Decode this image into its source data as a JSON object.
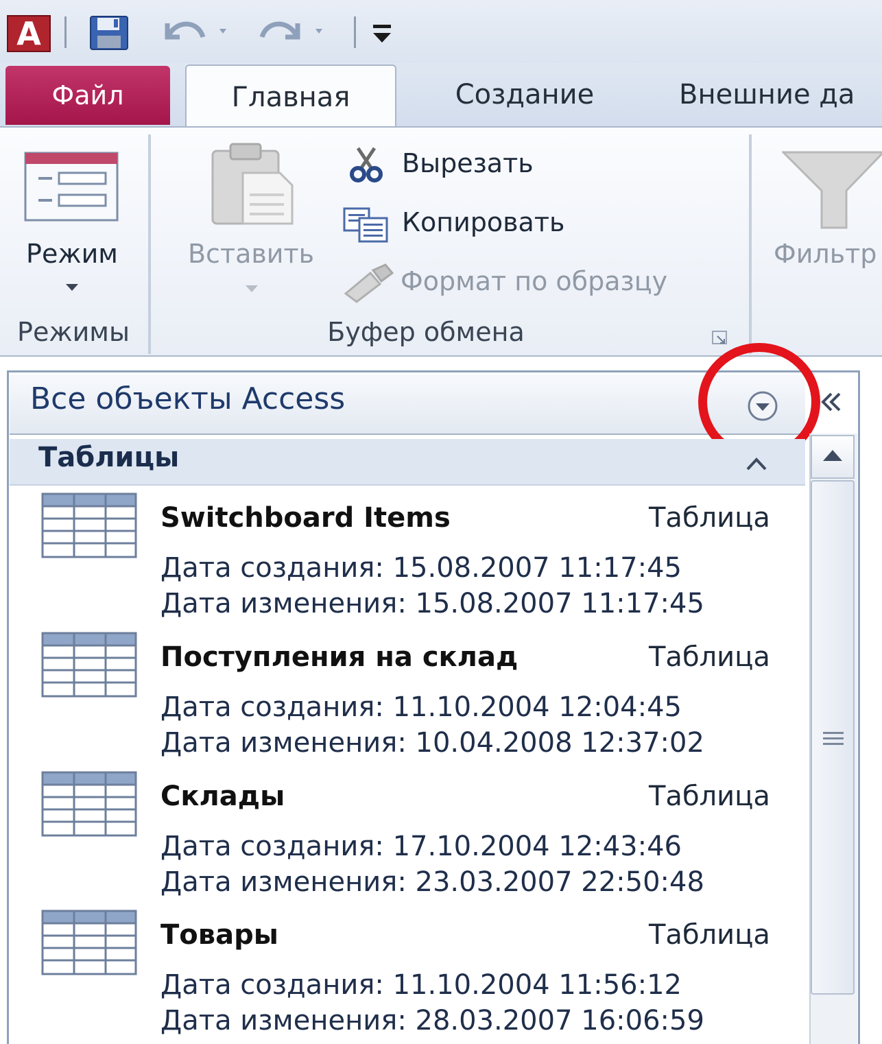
{
  "quick_access": {
    "logo_letter": "A"
  },
  "tabs": {
    "file": "Файл",
    "home": "Главная",
    "create": "Создание",
    "external": "Внешние да"
  },
  "ribbon": {
    "views": {
      "button_label": "Режим",
      "group_label": "Режимы"
    },
    "clipboard": {
      "paste_label": "Вставить",
      "cut_label": "Вырезать",
      "copy_label": "Копировать",
      "format_painter_label": "Формат по образцу",
      "group_label": "Буфер обмена"
    },
    "filter": {
      "button_label": "Фильтр"
    }
  },
  "nav_pane": {
    "title": "Все объекты Access",
    "group": {
      "title": "Таблицы"
    },
    "items": [
      {
        "name": "Switchboard Items",
        "type": "Таблица",
        "created": "Дата создания: 15.08.2007 11:17:45",
        "modified": "Дата изменения: 15.08.2007 11:17:45"
      },
      {
        "name": "Поступления на склад",
        "type": "Таблица",
        "created": "Дата создания: 11.10.2004 12:04:45",
        "modified": "Дата изменения: 10.04.2008 12:37:02"
      },
      {
        "name": "Склады",
        "type": "Таблица",
        "created": "Дата создания: 17.10.2004 12:43:46",
        "modified": "Дата изменения: 23.03.2007 22:50:48"
      },
      {
        "name": "Товары",
        "type": "Таблица",
        "created": "Дата создания: 11.10.2004 11:56:12",
        "modified": "Дата изменения: 28.03.2007 16:06:59"
      }
    ]
  },
  "colors": {
    "file_tab": "#b11f53",
    "highlight_circle": "#e3141b",
    "nav_title": "#1f3a6b"
  }
}
